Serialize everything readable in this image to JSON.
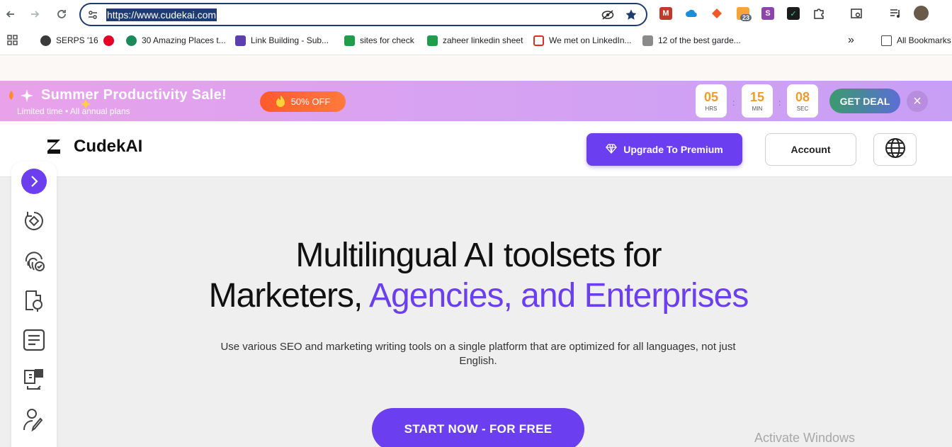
{
  "browser": {
    "url": "https://www.cudekai.com",
    "ext_badge": "23",
    "bookmarks": [
      {
        "label": "SERPS '16",
        "color": "#3a3a3a"
      },
      {
        "label": "30 Amazing Places t...",
        "color": "#1a8a5a"
      },
      {
        "label": "Link Building - Sub...",
        "color": "#5b3fb0"
      },
      {
        "label": "sites for check",
        "color": "#1e9e4a"
      },
      {
        "label": "zaheer linkedin sheet",
        "color": "#1e9e4a"
      },
      {
        "label": "We met on LinkedIn...",
        "color": "#d93025"
      },
      {
        "label": "12 of the best garde...",
        "color": "#8a8a8a"
      }
    ],
    "all_bookmarks": "All Bookmarks",
    "overflow": "»"
  },
  "promo": {
    "title": "Summer Productivity Sale!",
    "subtitle": "Limited time • All annual plans",
    "discount": "50% OFF",
    "countdown": [
      {
        "value": "05",
        "unit": "HRS"
      },
      {
        "value": "15",
        "unit": "MIN"
      },
      {
        "value": "08",
        "unit": "SEC"
      }
    ],
    "separator": ":",
    "cta": "GET DEAL",
    "close": "×"
  },
  "header": {
    "brand": "CudekAI",
    "upgrade": "Upgrade To Premium",
    "account": "Account"
  },
  "hero": {
    "line1": "Multilingual AI toolsets for",
    "line2_plain": "Marketers, ",
    "line2_accent": "Agencies, and Enterprises",
    "description": "Use various SEO and marketing writing tools on a single platform that are optimized for all languages, not just English.",
    "cta": "START NOW - FOR FREE"
  },
  "overlay": {
    "watermark": "Activate Windows"
  },
  "colors": {
    "accent": "#6b3ff0",
    "countdown": "#f29a2b"
  }
}
